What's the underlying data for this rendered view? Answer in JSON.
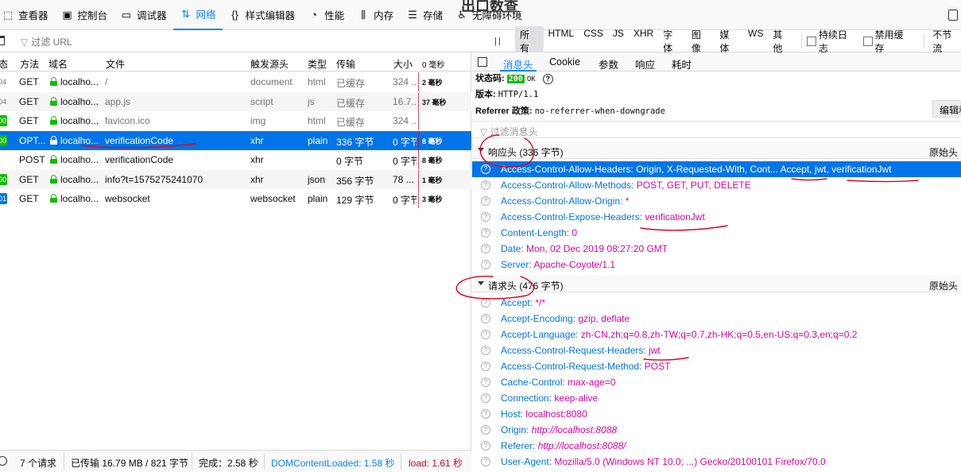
{
  "toolbar": {
    "tools": [
      {
        "label": "查看器",
        "icon": "inspector-icon",
        "glyph": "⬚"
      },
      {
        "label": "控制台",
        "icon": "console-icon",
        "glyph": "▣"
      },
      {
        "label": "调试器",
        "icon": "debugger-icon",
        "glyph": "▭"
      },
      {
        "label": "网络",
        "icon": "network-icon",
        "glyph": "⇅"
      },
      {
        "label": "样式编辑器",
        "icon": "style-editor-icon",
        "glyph": "{}"
      },
      {
        "label": "性能",
        "icon": "performance-icon",
        "glyph": "◔"
      },
      {
        "label": "内存",
        "icon": "memory-icon",
        "glyph": "⫼"
      },
      {
        "label": "存储",
        "icon": "storage-icon",
        "glyph": "☰"
      },
      {
        "label": "无障碍环境",
        "icon": "accessibility-icon",
        "glyph": "♿"
      }
    ],
    "peek_text": "出口数查",
    "active_color": "#0a84ff"
  },
  "filterbar": {
    "url_placeholder": "过滤 URL",
    "types": [
      "所有",
      "HTML",
      "CSS",
      "JS",
      "XHR",
      "字体",
      "图像",
      "媒体",
      "WS",
      "其他"
    ],
    "selected_type": "所有",
    "persist_logs": "持续日志",
    "disable_cache": "禁用缓存",
    "throttle": "不节流"
  },
  "table": {
    "headers": {
      "status": "态",
      "method": "方法",
      "domain": "域名",
      "file": "文件",
      "cause": "触发源头",
      "type": "类型",
      "transferred": "传输",
      "size": "大小",
      "waterfall": "0 毫秒"
    },
    "rows": [
      {
        "status": "04",
        "status_color": "#737373",
        "method": "GET",
        "domain": "localho...",
        "file": "/",
        "cause": "document",
        "type": "html",
        "transferred": "已缓存",
        "size": "324 ...",
        "timing": "2 毫秒",
        "muted": true
      },
      {
        "status": "04",
        "status_color": "#737373",
        "method": "GET",
        "domain": "localho...",
        "file": "app.js",
        "cause": "script",
        "type": "js",
        "transferred": "已缓存",
        "size": "16.7...",
        "timing": "37 毫秒",
        "muted": true
      },
      {
        "status": "00",
        "status_color": "#12bc00",
        "method": "GET",
        "domain": "localho...",
        "file": "favicon.ico",
        "cause": "img",
        "type": "html",
        "transferred": "已缓存",
        "size": "324 ...",
        "timing": "",
        "muted": true
      },
      {
        "status": "00",
        "status_color": "#12bc00",
        "method": "OPT...",
        "domain": "localho...",
        "file": "verificationCode",
        "cause": "xhr",
        "type": "plain",
        "transferred": "336 字节",
        "size": "0 字节",
        "timing": "8 毫秒",
        "muted": false,
        "selected": true
      },
      {
        "status": "",
        "status_color": "",
        "method": "POST",
        "domain": "localho...",
        "file": "verificationCode",
        "cause": "xhr",
        "type": "",
        "transferred": "0 字节",
        "size": "0 字节",
        "timing": "8 毫秒",
        "muted": false
      },
      {
        "status": "00",
        "status_color": "#12bc00",
        "method": "GET",
        "domain": "localho...",
        "file": "info?t=1575275241070",
        "cause": "xhr",
        "type": "json",
        "transferred": "356 字节",
        "size": "78 ...",
        "timing": "1 毫秒",
        "muted": false
      },
      {
        "status": "01",
        "status_color": "#0074e8",
        "method": "GET",
        "domain": "localho...",
        "file": "websocket",
        "cause": "websocket",
        "type": "plain",
        "transferred": "129 字节",
        "size": "0 字节",
        "timing": "3 毫秒",
        "muted": false
      }
    ]
  },
  "statusbar": {
    "requests": "7 个请求",
    "transferred": "已传输 16.79 MB / 821 字节",
    "finish": "完成：2.58 秒",
    "dcl": "DOMContentLoaded: 1.58 秒",
    "load": "load: 1.61 秒"
  },
  "details": {
    "tabs": [
      "消息头",
      "Cookie",
      "参数",
      "响应",
      "耗时"
    ],
    "active_tab": "消息头",
    "status_label": "状态码:",
    "status_code": "200",
    "status_text": "OK",
    "version_label": "版本:",
    "version": "HTTP/1.1",
    "referrer_label": "Referrer 政策:",
    "referrer": "no-referrer-when-downgrade",
    "edit_button": "编辑和重发",
    "header_filter_placeholder": "过滤消息头",
    "response_section": "响应头 (336 字节)",
    "request_section": "请求头 (476 字节)",
    "raw_label": "原始头",
    "response_headers": [
      {
        "k": "Access-Control-Allow-Headers:",
        "v": "Origin, X-Requested-With, Cont... Accept, jwt, verificationJwt",
        "selected": true
      },
      {
        "k": "Access-Control-Allow-Methods:",
        "v": "POST, GET, PUT, DELETE"
      },
      {
        "k": "Access-Control-Allow-Origin:",
        "v": "*"
      },
      {
        "k": "Access-Control-Expose-Headers:",
        "v": "verificationJwt"
      },
      {
        "k": "Content-Length:",
        "v": "0"
      },
      {
        "k": "Date:",
        "v": "Mon, 02 Dec 2019 08:27:20 GMT"
      },
      {
        "k": "Server:",
        "v": "Apache-Coyote/1.1"
      }
    ],
    "request_headers": [
      {
        "k": "Accept:",
        "v": "*/*"
      },
      {
        "k": "Accept-Encoding:",
        "v": "gzip, deflate"
      },
      {
        "k": "Accept-Language:",
        "v": "zh-CN,zh;q=0.8,zh-TW;q=0.7,zh-HK;q=0.5,en-US;q=0.3,en;q=0.2"
      },
      {
        "k": "Access-Control-Request-Headers:",
        "v": "jwt"
      },
      {
        "k": "Access-Control-Request-Method:",
        "v": "POST"
      },
      {
        "k": "Cache-Control:",
        "v": "max-age=0"
      },
      {
        "k": "Connection:",
        "v": "keep-alive"
      },
      {
        "k": "Host:",
        "v": "localhost:8080"
      },
      {
        "k": "Origin:",
        "v": "http://localhost:8088",
        "italic": true
      },
      {
        "k": "Referer:",
        "v": "http://localhost:8088/",
        "italic": true
      },
      {
        "k": "User-Agent:",
        "v": "Mozilla/5.0 (Windows NT 10.0; ...) Gecko/20100101 Firefox/70.0"
      }
    ]
  },
  "colors": {
    "header_key": "#0074e8",
    "header_value": "#dd00a9",
    "selected_row": "#0074e8",
    "annotation": "#e8001c"
  }
}
